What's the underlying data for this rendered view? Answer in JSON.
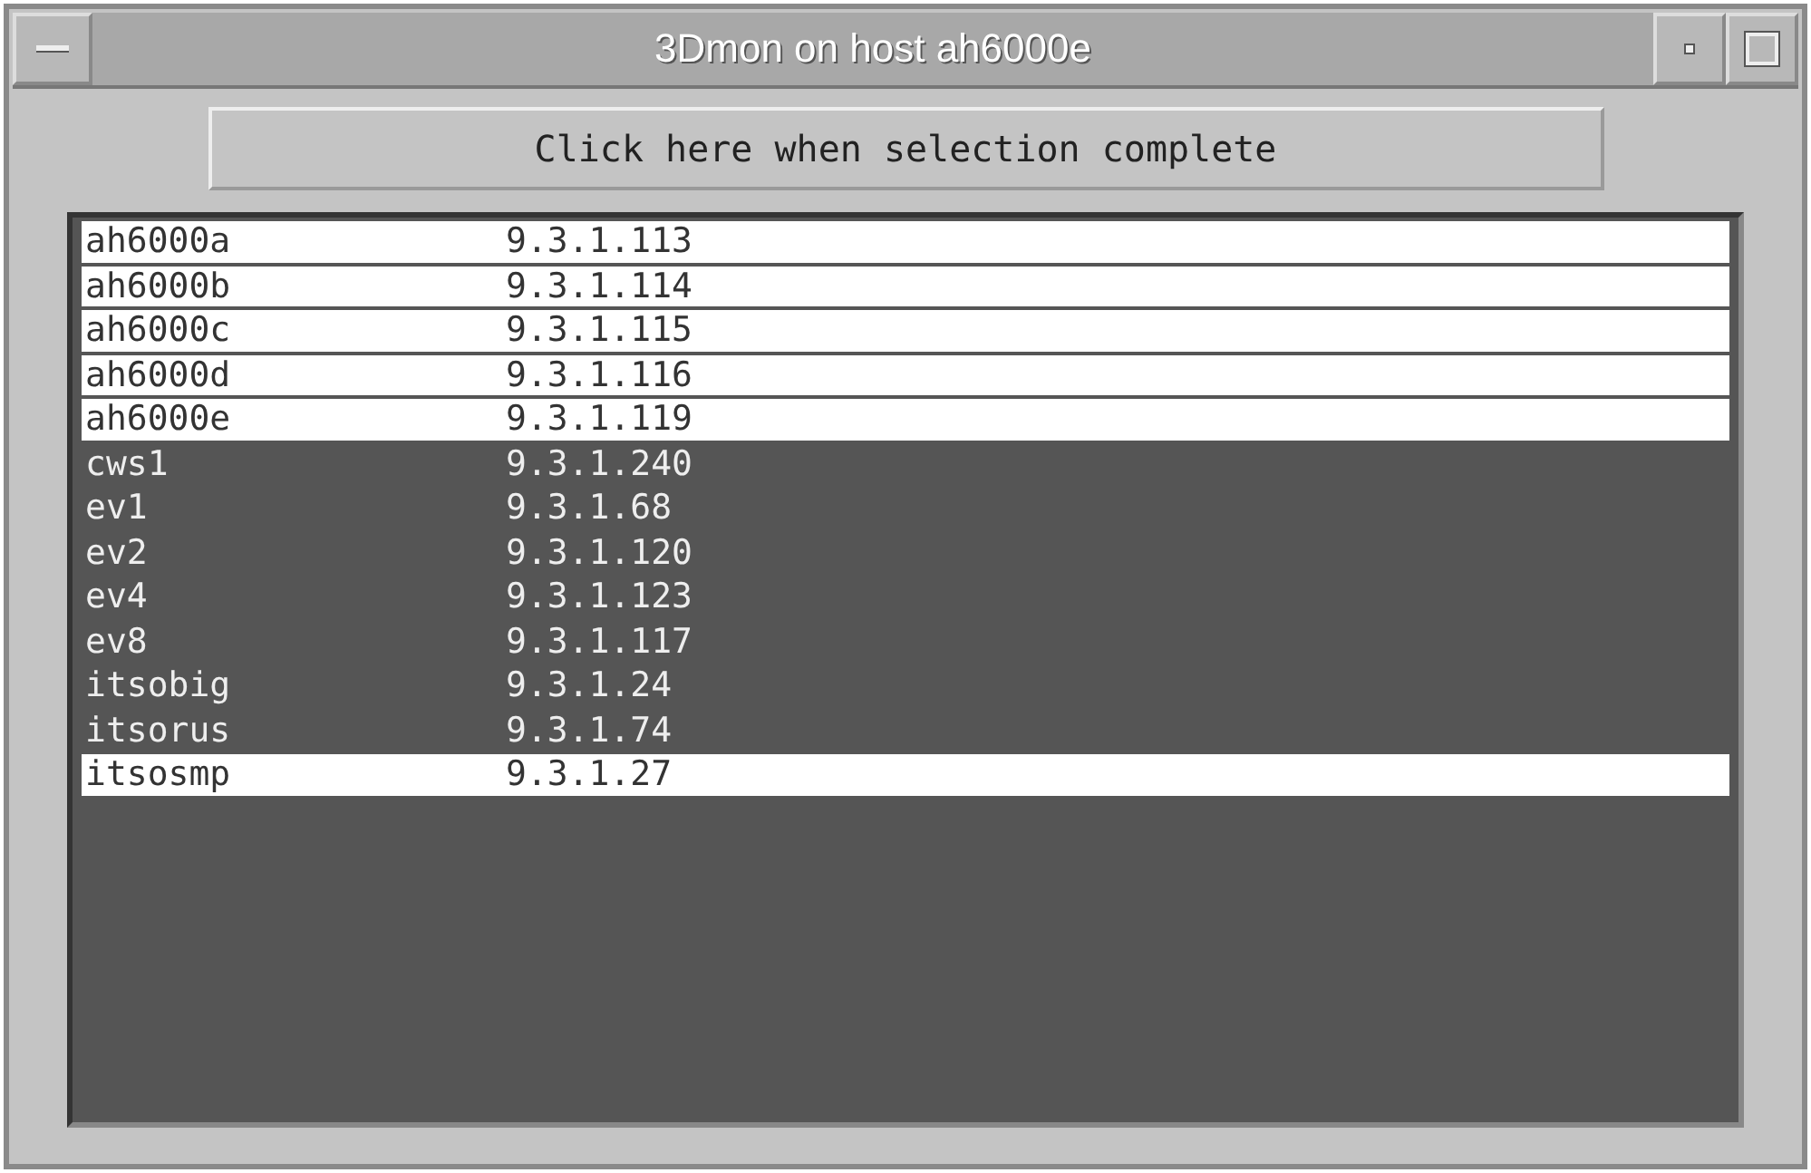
{
  "window": {
    "title": "3Dmon on host ah6000e"
  },
  "action_button": {
    "label": "Click here when selection complete"
  },
  "hosts": [
    {
      "name": "ah6000a",
      "address": "9.3.1.113",
      "selected": true
    },
    {
      "name": "ah6000b",
      "address": "9.3.1.114",
      "selected": true
    },
    {
      "name": "ah6000c",
      "address": "9.3.1.115",
      "selected": true
    },
    {
      "name": "ah6000d",
      "address": "9.3.1.116",
      "selected": true
    },
    {
      "name": "ah6000e",
      "address": "9.3.1.119",
      "selected": true
    },
    {
      "name": "cws1",
      "address": "9.3.1.240",
      "selected": false
    },
    {
      "name": "ev1",
      "address": "9.3.1.68",
      "selected": false
    },
    {
      "name": "ev2",
      "address": "9.3.1.120",
      "selected": false
    },
    {
      "name": "ev4",
      "address": "9.3.1.123",
      "selected": false
    },
    {
      "name": "ev8",
      "address": "9.3.1.117",
      "selected": false
    },
    {
      "name": "itsobig",
      "address": "9.3.1.24",
      "selected": false
    },
    {
      "name": "itsorus",
      "address": "9.3.1.74",
      "selected": false
    },
    {
      "name": "itsosmp",
      "address": "9.3.1.27",
      "selected": true
    }
  ]
}
